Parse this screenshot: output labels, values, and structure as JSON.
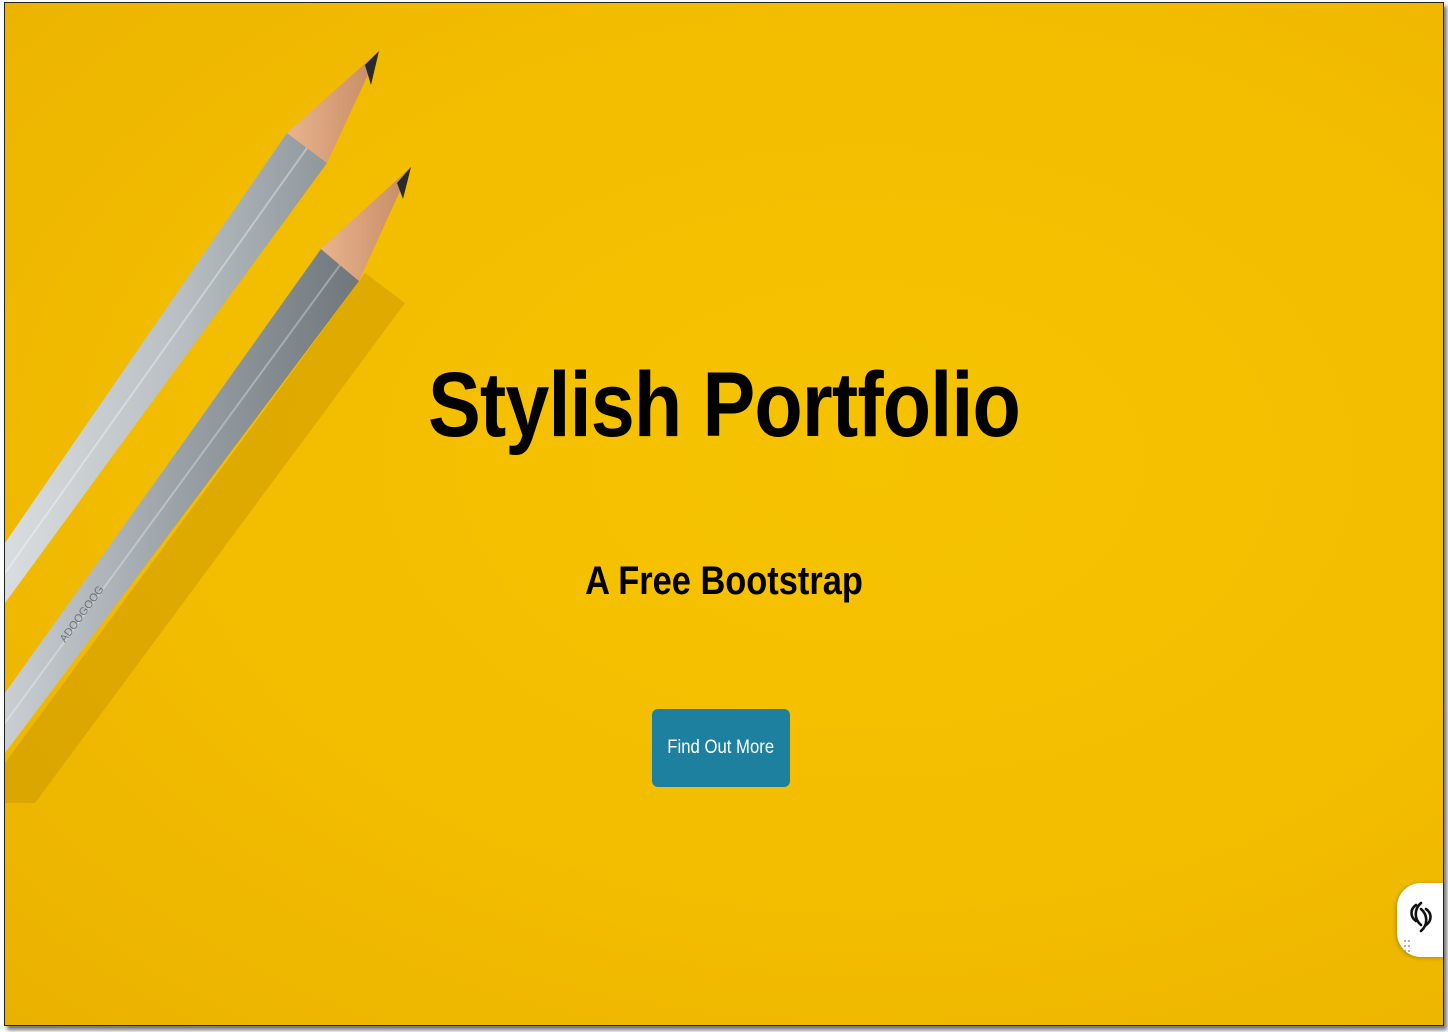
{
  "hero": {
    "title": "Stylish Portfolio",
    "subtitle": "A Free Bootstrap",
    "cta_label": "Find Out More"
  },
  "colors": {
    "background": "#f3bd00",
    "button": "#1d809f",
    "text": "#000000"
  },
  "icons": {
    "pencils": "pencils-image",
    "widget": "accessibility-widget-icon",
    "drag": "drag-handle-icon"
  }
}
